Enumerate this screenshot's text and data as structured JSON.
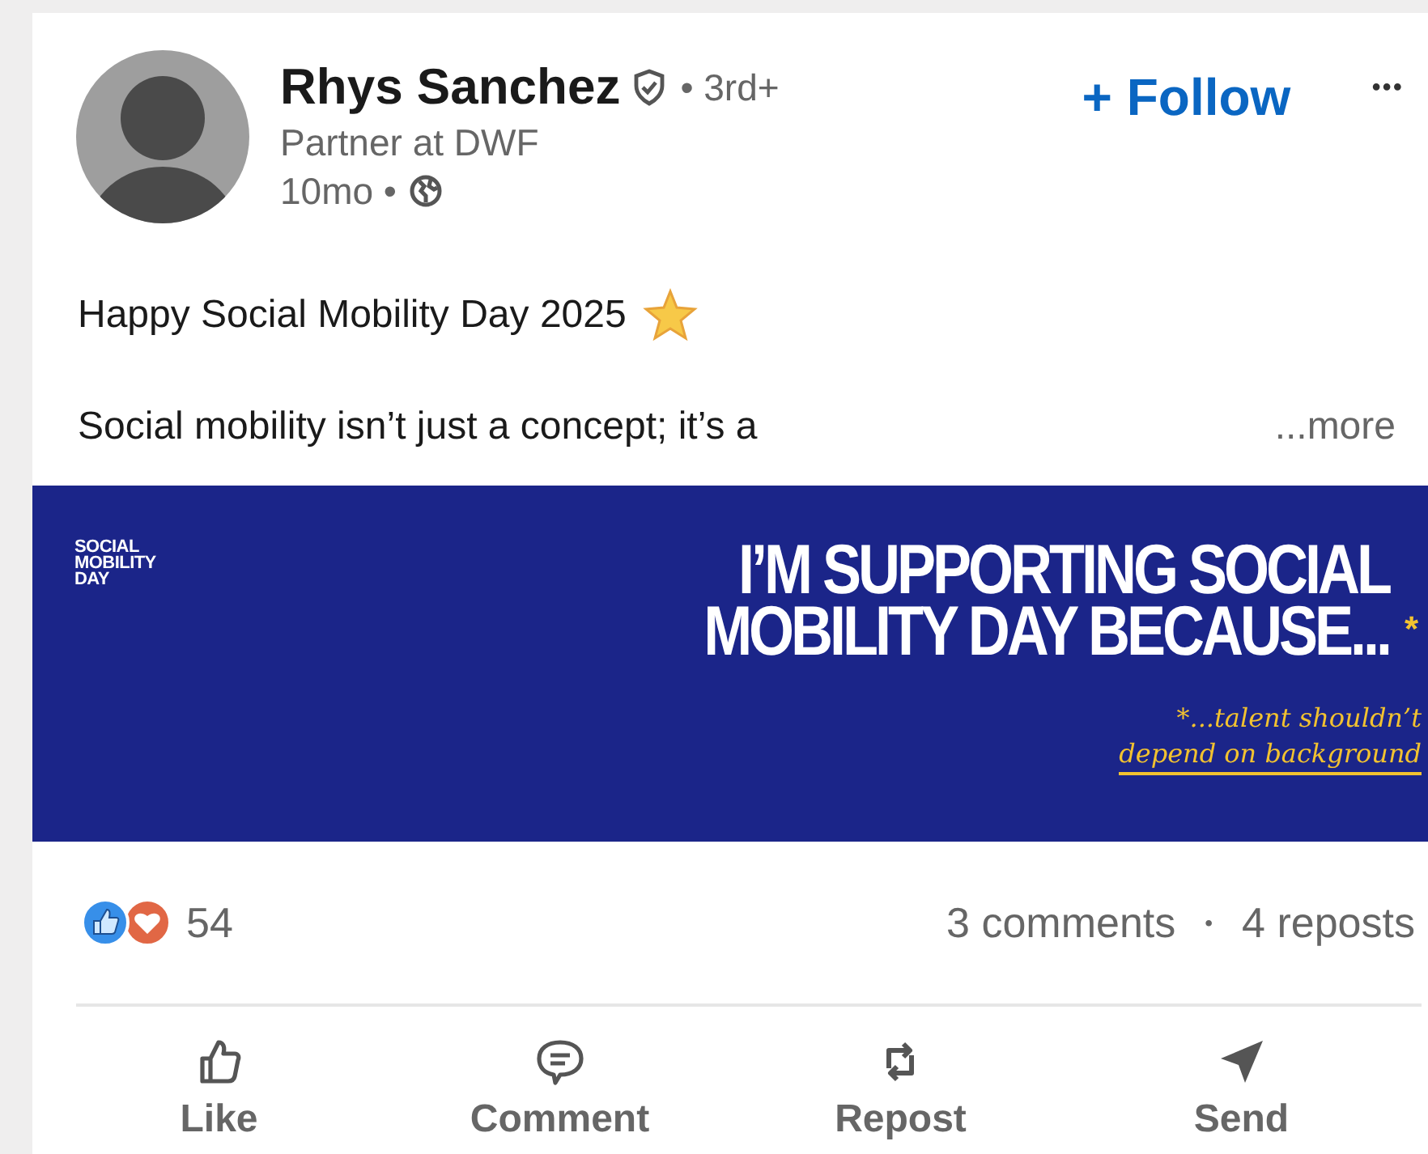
{
  "author": {
    "name": "Rhys Sanchez",
    "degree": "• 3rd+",
    "headline": "Partner at DWF",
    "time": "10mo •"
  },
  "follow": {
    "plus": "+",
    "label": "Follow"
  },
  "more_menu": "•••",
  "post": {
    "title": "Happy Social Mobility Day 2025",
    "body": "Social mobility isn’t just a concept; it’s a",
    "more": "...more"
  },
  "banner": {
    "logo": [
      "SOCIAL",
      "MOBILITY",
      "DAY"
    ],
    "headline": [
      "I’M SUPPORTING SOCIAL",
      "MOBILITY DAY BECAUSE..."
    ],
    "asterisk": "*",
    "quote": [
      "*...talent shouldn’t",
      "depend on background"
    ]
  },
  "social": {
    "reactions": "54",
    "comments": "3 comments",
    "separator": "•",
    "reposts": "4 reposts"
  },
  "actions": [
    {
      "kind": "like",
      "label": "Like"
    },
    {
      "kind": "comment",
      "label": "Comment"
    },
    {
      "kind": "repost",
      "label": "Repost"
    },
    {
      "kind": "send",
      "label": "Send"
    }
  ]
}
